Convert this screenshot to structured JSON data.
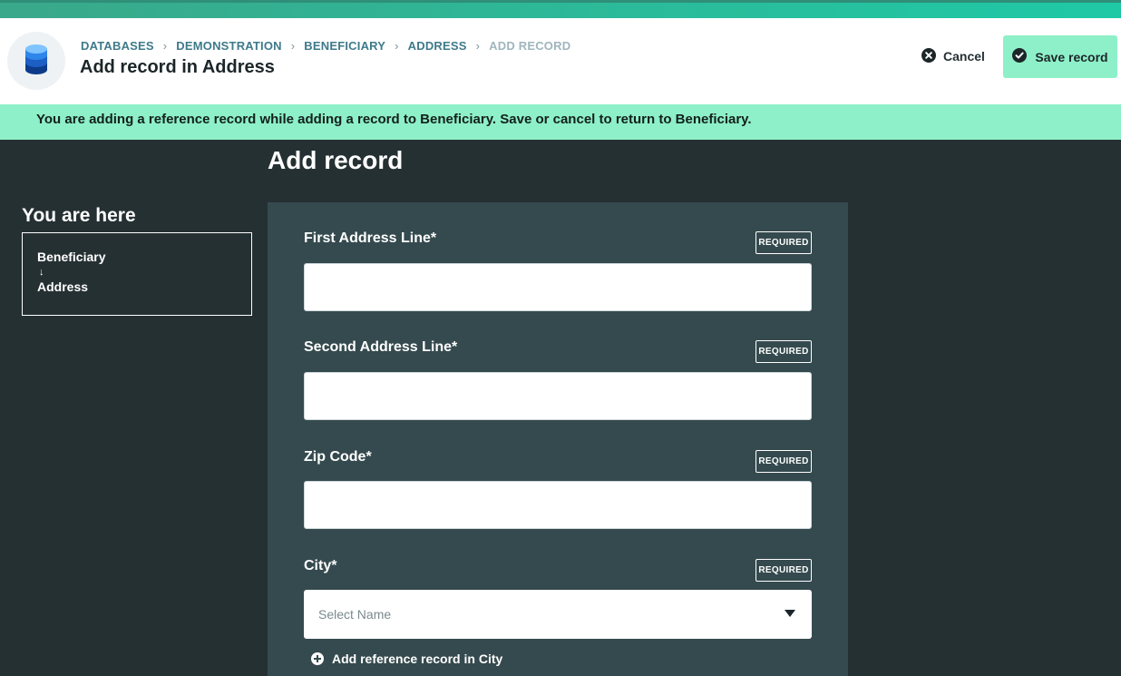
{
  "breadcrumb": {
    "items": [
      "DATABASES",
      "DEMONSTRATION",
      "BENEFICIARY",
      "ADDRESS",
      "ADD RECORD"
    ]
  },
  "header": {
    "title": "Add record in Address",
    "icon": "database-icon"
  },
  "actions": {
    "cancel_label": "Cancel",
    "save_label": "Save record"
  },
  "notice": {
    "text": "You are adding a reference record while adding a record to Beneficiary. Save or cancel to return to Beneficiary."
  },
  "sidebar": {
    "title": "You are here",
    "path": [
      "Beneficiary",
      "Address"
    ],
    "arrow": "↓"
  },
  "form": {
    "title": "Add record",
    "required_badge": "REQUIRED",
    "fields": [
      {
        "label": "First Address Line*",
        "value": ""
      },
      {
        "label": "Second Address Line*",
        "value": ""
      },
      {
        "label": "Zip Code*",
        "value": ""
      },
      {
        "label": "City*",
        "placeholder": "Select Name"
      }
    ],
    "add_reference_label": "Add reference record in City"
  },
  "colors": {
    "accent": "#8ef0c8",
    "background": "#253033",
    "panel": "#354a4e",
    "breadcrumb": "#3e7a8a"
  }
}
